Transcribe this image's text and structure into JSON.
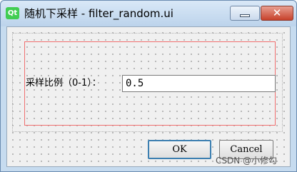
{
  "window": {
    "app_icon_text": "Qt",
    "title": "随机下采样 - filter_random.ui",
    "close_glyph": "✕"
  },
  "form": {
    "label": "采样比例（0-1）：",
    "ratio_value": "0.5"
  },
  "buttons": {
    "ok_label": "OK",
    "cancel_label": "Cancel"
  },
  "watermark": "CSDN @小修勾",
  "colors": {
    "qt_icon": "#41cd52",
    "close_button": "#c7412a",
    "red_layout_box": "#f07070",
    "ok_focus_border": "#3c7fb1"
  }
}
